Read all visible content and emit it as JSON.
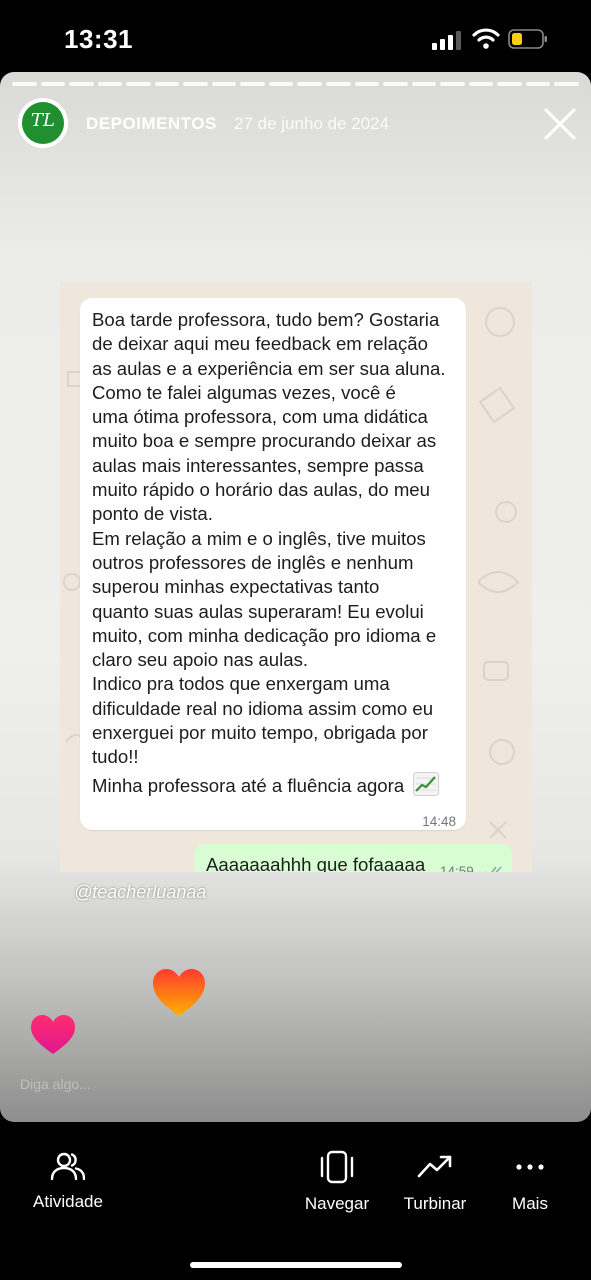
{
  "status_bar": {
    "time": "13:31",
    "icons": [
      "signal-icon",
      "wifi-icon",
      "battery-icon"
    ],
    "battery_color": "#f5d00b"
  },
  "story": {
    "highlight_title": "DEPOIMENTOS",
    "date": "27 de junho de 2024",
    "avatar_monogram": "TL",
    "avatar_color": "#1f8f2f",
    "mention": "@teacherluanaa",
    "reply_placeholder": "Diga algo..."
  },
  "chat": {
    "message": "Boa tarde professora, tudo bem? Gostaria\nde deixar aqui meu feedback em relação\nas aulas e a experiência em ser sua aluna.\nComo te falei algumas vezes, você é\numa ótima professora, com uma didática\nmuito boa e sempre procurando deixar as\naulas mais interessantes, sempre passa\nmuito rápido o horário das aulas, do meu\nponto de vista.\nEm relação a mim e o inglês, tive muitos\noutros professores de inglês e nenhum\nsuperou minhas expectativas tanto\nquanto suas aulas superaram! Eu evolui\nmuito, com minha dedicação pro idioma e\nclaro seu apoio nas aulas.\nIndico pra todos que enxergam uma\ndificuldade real no idioma assim como eu\nenxerguei por muito tempo, obrigada por\ntudo!!",
    "message_last_line": "Minha professora até a fluência agora",
    "message_time": "14:48",
    "reply": "Aaaaaaahhh que fofaaaaa",
    "reply_time": "14:59",
    "bubble_color": "#ffffff",
    "reply_bubble_color": "#d9fdd3"
  },
  "bottom_nav": {
    "items": [
      {
        "label": "Atividade",
        "icon": "people-icon"
      },
      {
        "label": "Navegar",
        "icon": "carousel-icon"
      },
      {
        "label": "Turbinar",
        "icon": "trending-up-icon"
      },
      {
        "label": "Mais",
        "icon": "more-icon"
      }
    ]
  }
}
